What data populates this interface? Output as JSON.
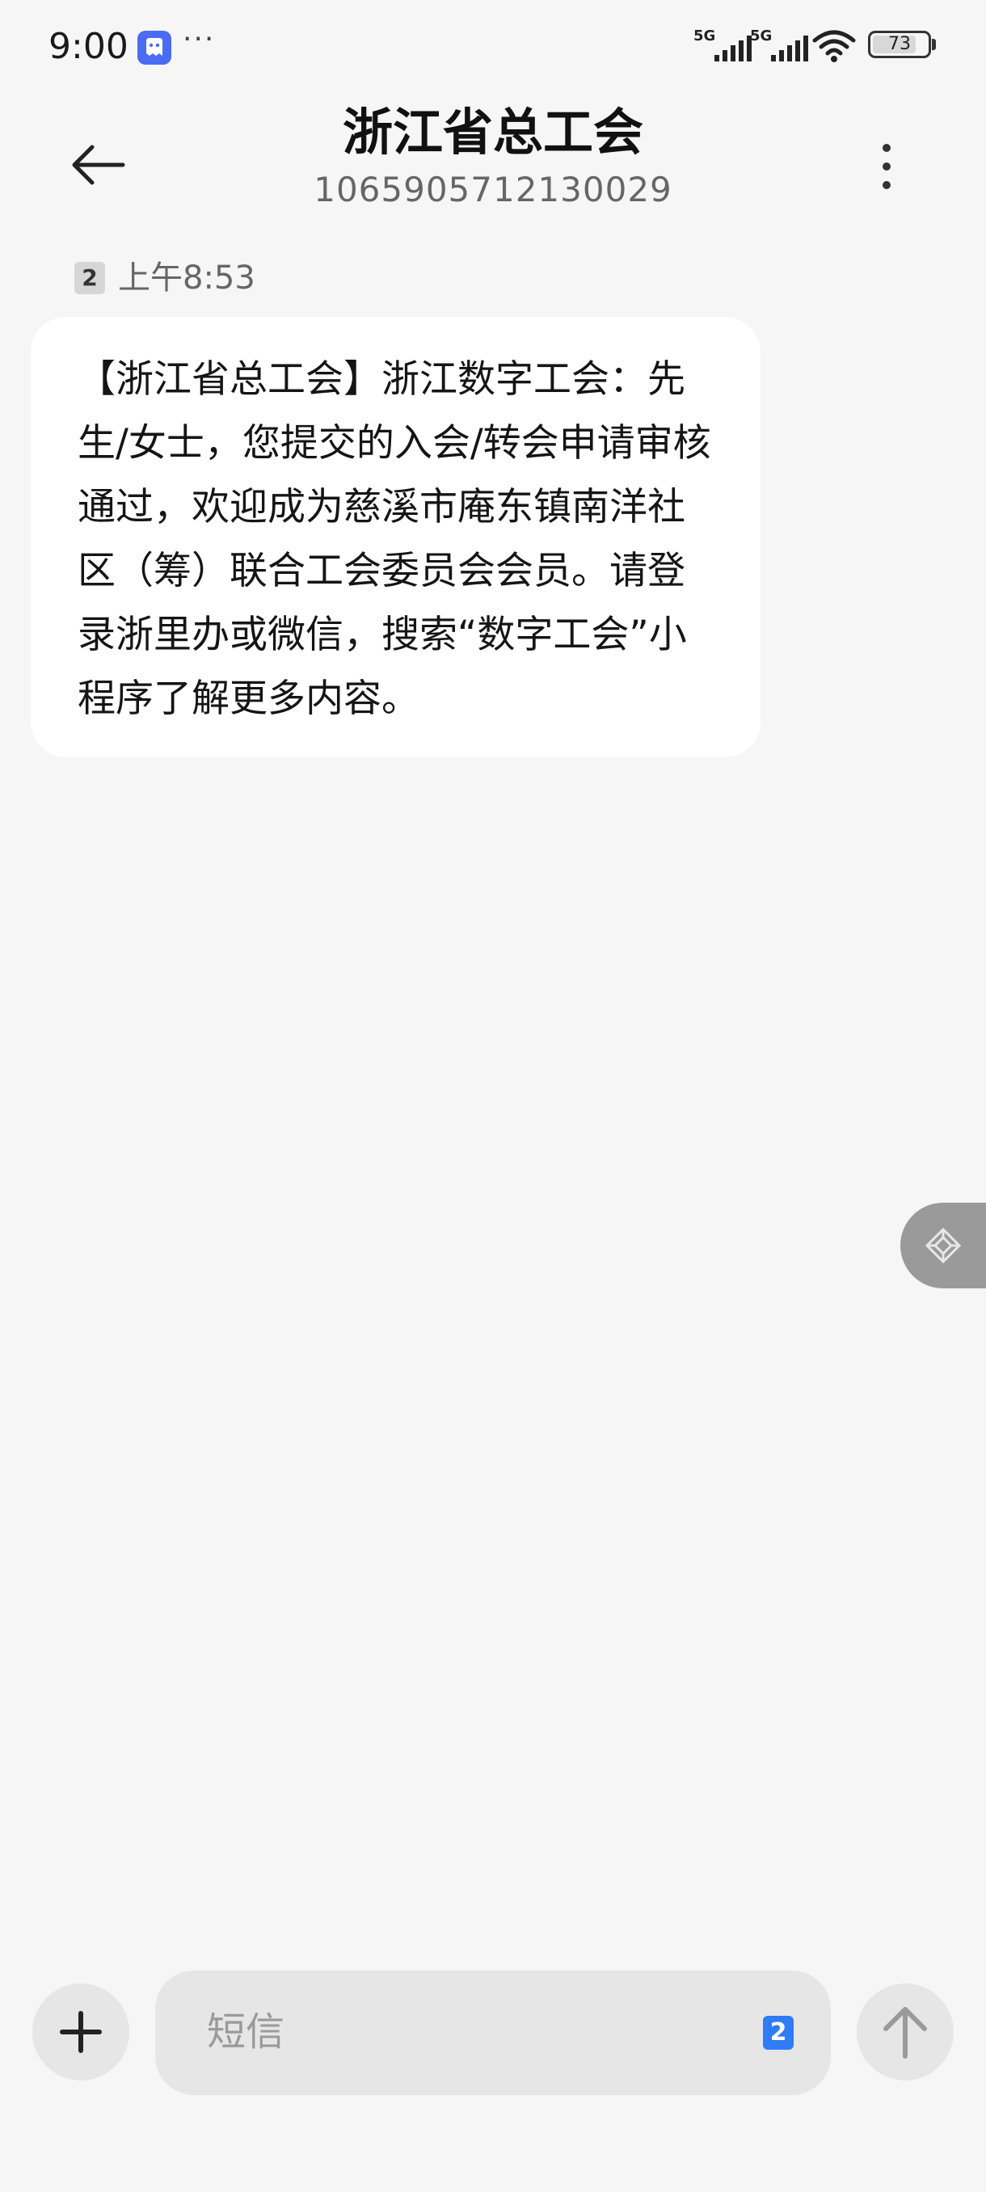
{
  "status_bar": {
    "time": "9:00",
    "more_indicator": "···",
    "network_1": "5G",
    "network_2": "5G",
    "battery_level": "73",
    "icons": [
      "notification-app-icon",
      "signal-icon",
      "signal-icon",
      "wifi-icon",
      "battery-icon"
    ]
  },
  "header": {
    "title": "浙江省总工会",
    "number": "1065905712130029",
    "icons": [
      "back-arrow-icon",
      "more-vertical-icon"
    ]
  },
  "message": {
    "sim": "2",
    "time": "上午8:53",
    "text": "【浙江省总工会】浙江数字工会：先生/女士，您提交的入会/转会申请审核通过，欢迎成为慈溪市庵东镇南洋社区（筹）联合工会委员会会员。请登录浙里办或微信，搜索“数字工会”小程序了解更多内容。"
  },
  "floating_button": {
    "icon": "diamond-tool-icon"
  },
  "input_bar": {
    "placeholder": "短信",
    "sim": "2",
    "icons": [
      "plus-icon",
      "send-arrow-icon"
    ]
  },
  "colors": {
    "background": "#f6f6f6",
    "bubble": "#ffffff",
    "input_background": "#e6e6e6",
    "sim_badge_active": "#2e7cf6",
    "floating_button": "#9a9a9a"
  }
}
